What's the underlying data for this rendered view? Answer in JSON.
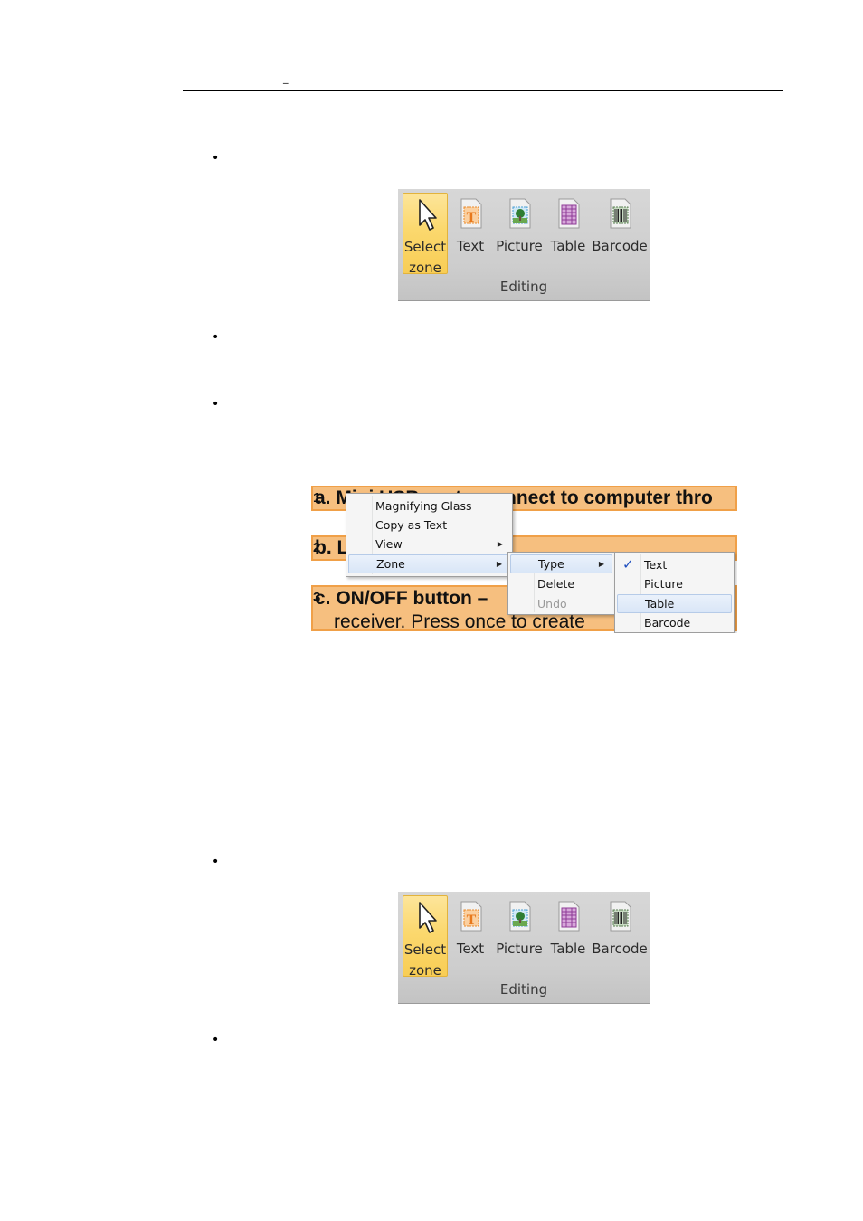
{
  "header": {
    "mark": "_"
  },
  "bullets": [
    "•",
    "•",
    "•",
    "•",
    "•"
  ],
  "ribbon": {
    "group_label": "Editing",
    "buttons": [
      {
        "label": "Select",
        "label2": "zone",
        "icon": "cursor-arrow-icon",
        "selected": true
      },
      {
        "label": "Text",
        "icon": "text-zone-icon",
        "selected": false
      },
      {
        "label": "Picture",
        "icon": "picture-zone-icon",
        "selected": false
      },
      {
        "label": "Table",
        "icon": "table-zone-icon",
        "selected": false
      },
      {
        "label": "Barcode",
        "icon": "barcode-zone-icon",
        "selected": false
      }
    ]
  },
  "preview": {
    "zones": [
      {
        "number": "1",
        "text": "a. Mini USB port – connect to computer thro"
      },
      {
        "number": "2",
        "text": "b. L"
      },
      {
        "number": "3",
        "text": "c. ON/OFF button –",
        "text2": "receiver.  Press once to create"
      }
    ],
    "context_menu": {
      "items": [
        "Magnifying Glass",
        "Copy as Text",
        "View",
        "Zone"
      ],
      "highlighted": "Zone"
    },
    "zone_menu": {
      "items": [
        "Type",
        "Delete",
        "Undo"
      ],
      "highlighted": "Type",
      "disabled": "Undo"
    },
    "type_menu": {
      "items": [
        "Text",
        "Picture",
        "Table",
        "Barcode"
      ],
      "checked": "Text",
      "hovered": "Table"
    }
  },
  "colors": {
    "zone_fill": "#f6bf7f",
    "zone_border": "#f0a048",
    "ribbon_selected": "#fbd86e",
    "menu_highlight": "#d9e6f7",
    "check": "#1f4fbf"
  }
}
